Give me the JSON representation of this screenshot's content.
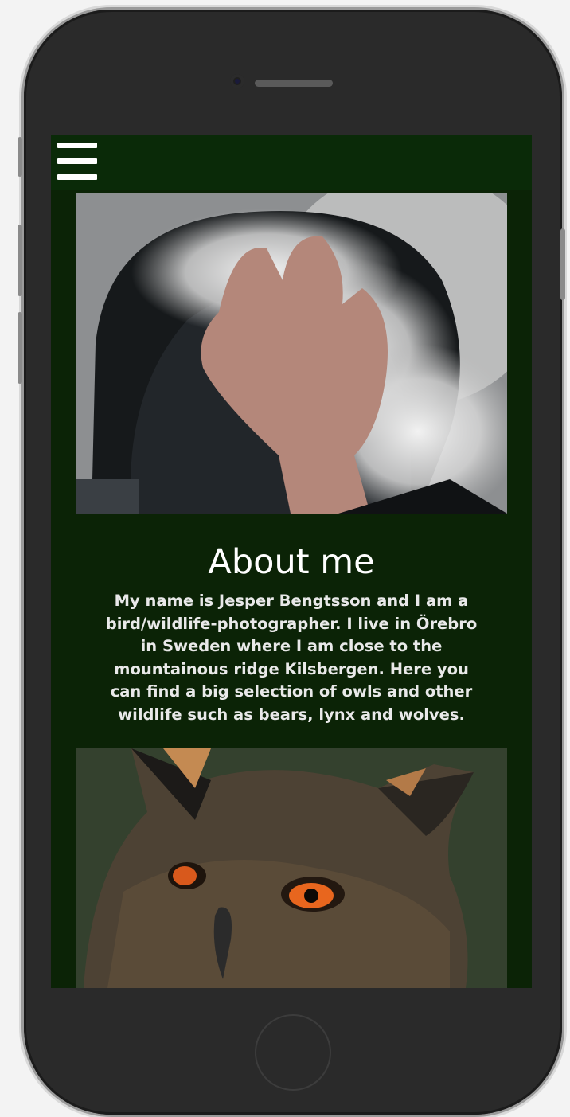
{
  "nav": {
    "menu_icon": "hamburger-menu-icon"
  },
  "about": {
    "title": "About me",
    "text": "My name is Jesper Bengtsson and I am a bird/wildlife-photographer. I live in Örebro in Sweden where I am close to the mountainous ridge Kilsbergen. Here you can find a big selection of owls and other wildlife such as bears, lynx and wolves."
  },
  "colors": {
    "nav": "#0a2a08",
    "page": "#0b2306",
    "text": "#ffffff"
  }
}
